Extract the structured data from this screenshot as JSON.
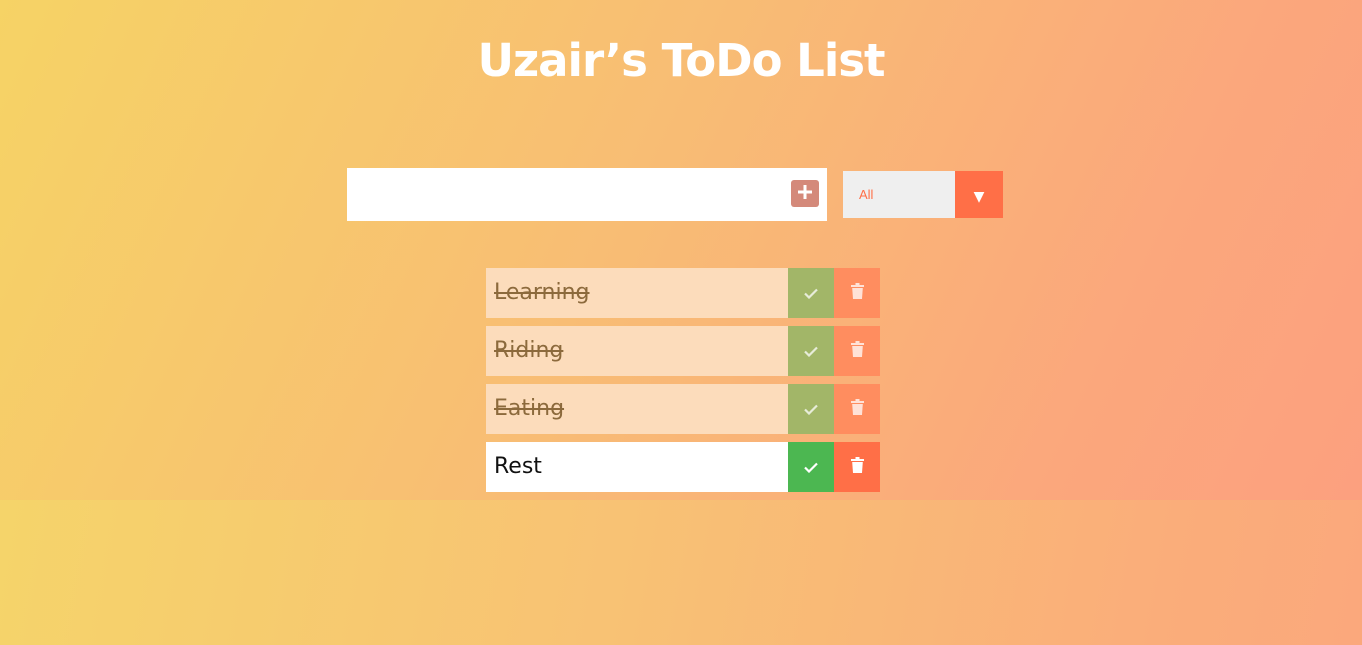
{
  "app": {
    "title": "Uzair’s ToDo List"
  },
  "form": {
    "input_value": "",
    "add_icon": "plus-icon",
    "filter": {
      "selected": "All",
      "arrow_icon": "chevron-down-icon"
    }
  },
  "colors": {
    "accent": "#ff6f47",
    "check": "#4cb751",
    "add_button": "#d4897a"
  },
  "todos": [
    {
      "text": "Learning",
      "completed": true
    },
    {
      "text": "Riding",
      "completed": true
    },
    {
      "text": "Eating",
      "completed": true
    },
    {
      "text": "Rest",
      "completed": false
    }
  ]
}
